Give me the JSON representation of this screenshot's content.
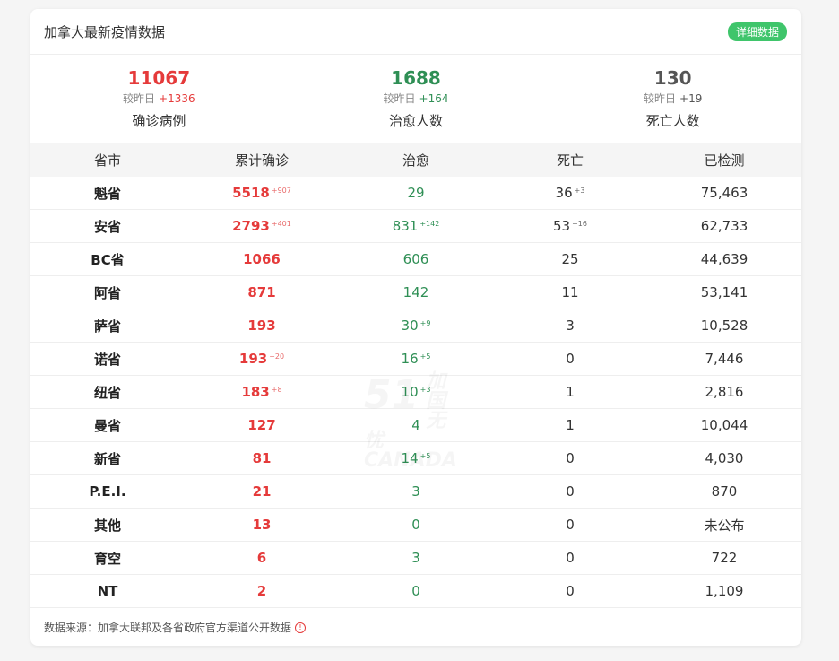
{
  "header": {
    "title": "加拿大最新疫情数据",
    "detail_label": "详细数据"
  },
  "summary": [
    {
      "value": "11067",
      "delta_label": "较昨日",
      "delta": "+1336",
      "label": "确诊病例",
      "color": "#e53a3a"
    },
    {
      "value": "1688",
      "delta_label": "较昨日",
      "delta": "+164",
      "label": "治愈人数",
      "color": "#2f8f55"
    },
    {
      "value": "130",
      "delta_label": "较昨日",
      "delta": "+19",
      "label": "死亡人数",
      "color": "#555555"
    }
  ],
  "table": {
    "headers": [
      "省市",
      "累计确诊",
      "治愈",
      "死亡",
      "已检测"
    ],
    "rows": [
      {
        "province": "魁省",
        "confirmed": "5518",
        "confirmed_inc": "+907",
        "cured": "29",
        "cured_inc": "",
        "death": "36",
        "death_inc": "+3",
        "tested": "75,463"
      },
      {
        "province": "安省",
        "confirmed": "2793",
        "confirmed_inc": "+401",
        "cured": "831",
        "cured_inc": "+142",
        "death": "53",
        "death_inc": "+16",
        "tested": "62,733"
      },
      {
        "province": "BC省",
        "confirmed": "1066",
        "confirmed_inc": "",
        "cured": "606",
        "cured_inc": "",
        "death": "25",
        "death_inc": "",
        "tested": "44,639"
      },
      {
        "province": "阿省",
        "confirmed": "871",
        "confirmed_inc": "",
        "cured": "142",
        "cured_inc": "",
        "death": "11",
        "death_inc": "",
        "tested": "53,141"
      },
      {
        "province": "萨省",
        "confirmed": "193",
        "confirmed_inc": "",
        "cured": "30",
        "cured_inc": "+9",
        "death": "3",
        "death_inc": "",
        "tested": "10,528"
      },
      {
        "province": "诺省",
        "confirmed": "193",
        "confirmed_inc": "+20",
        "cured": "16",
        "cured_inc": "+5",
        "death": "0",
        "death_inc": "",
        "tested": "7,446"
      },
      {
        "province": "纽省",
        "confirmed": "183",
        "confirmed_inc": "+8",
        "cured": "10",
        "cured_inc": "+3",
        "death": "1",
        "death_inc": "",
        "tested": "2,816"
      },
      {
        "province": "曼省",
        "confirmed": "127",
        "confirmed_inc": "",
        "cured": "4",
        "cured_inc": "",
        "death": "1",
        "death_inc": "",
        "tested": "10,044"
      },
      {
        "province": "新省",
        "confirmed": "81",
        "confirmed_inc": "",
        "cured": "14",
        "cured_inc": "+5",
        "death": "0",
        "death_inc": "",
        "tested": "4,030"
      },
      {
        "province": "P.E.I.",
        "confirmed": "21",
        "confirmed_inc": "",
        "cured": "3",
        "cured_inc": "",
        "death": "0",
        "death_inc": "",
        "tested": "870"
      },
      {
        "province": "其他",
        "confirmed": "13",
        "confirmed_inc": "",
        "cured": "0",
        "cured_inc": "",
        "death": "0",
        "death_inc": "",
        "tested": "未公布"
      },
      {
        "province": "育空",
        "confirmed": "6",
        "confirmed_inc": "",
        "cured": "3",
        "cured_inc": "",
        "death": "0",
        "death_inc": "",
        "tested": "722"
      },
      {
        "province": "NT",
        "confirmed": "2",
        "confirmed_inc": "",
        "cured": "0",
        "cured_inc": "",
        "death": "0",
        "death_inc": "",
        "tested": "1,109"
      }
    ]
  },
  "watermark": {
    "number": "51",
    "line1": "加国无忧",
    "line2": "CANADA"
  },
  "footer": {
    "source": "数据来源：加拿大联邦及各省政府官方渠道公开数据",
    "info_icon": "info-icon"
  },
  "colors": {
    "confirmed": "#e53a3a",
    "cured": "#2f8f55",
    "accent_button": "#3fc56b"
  }
}
